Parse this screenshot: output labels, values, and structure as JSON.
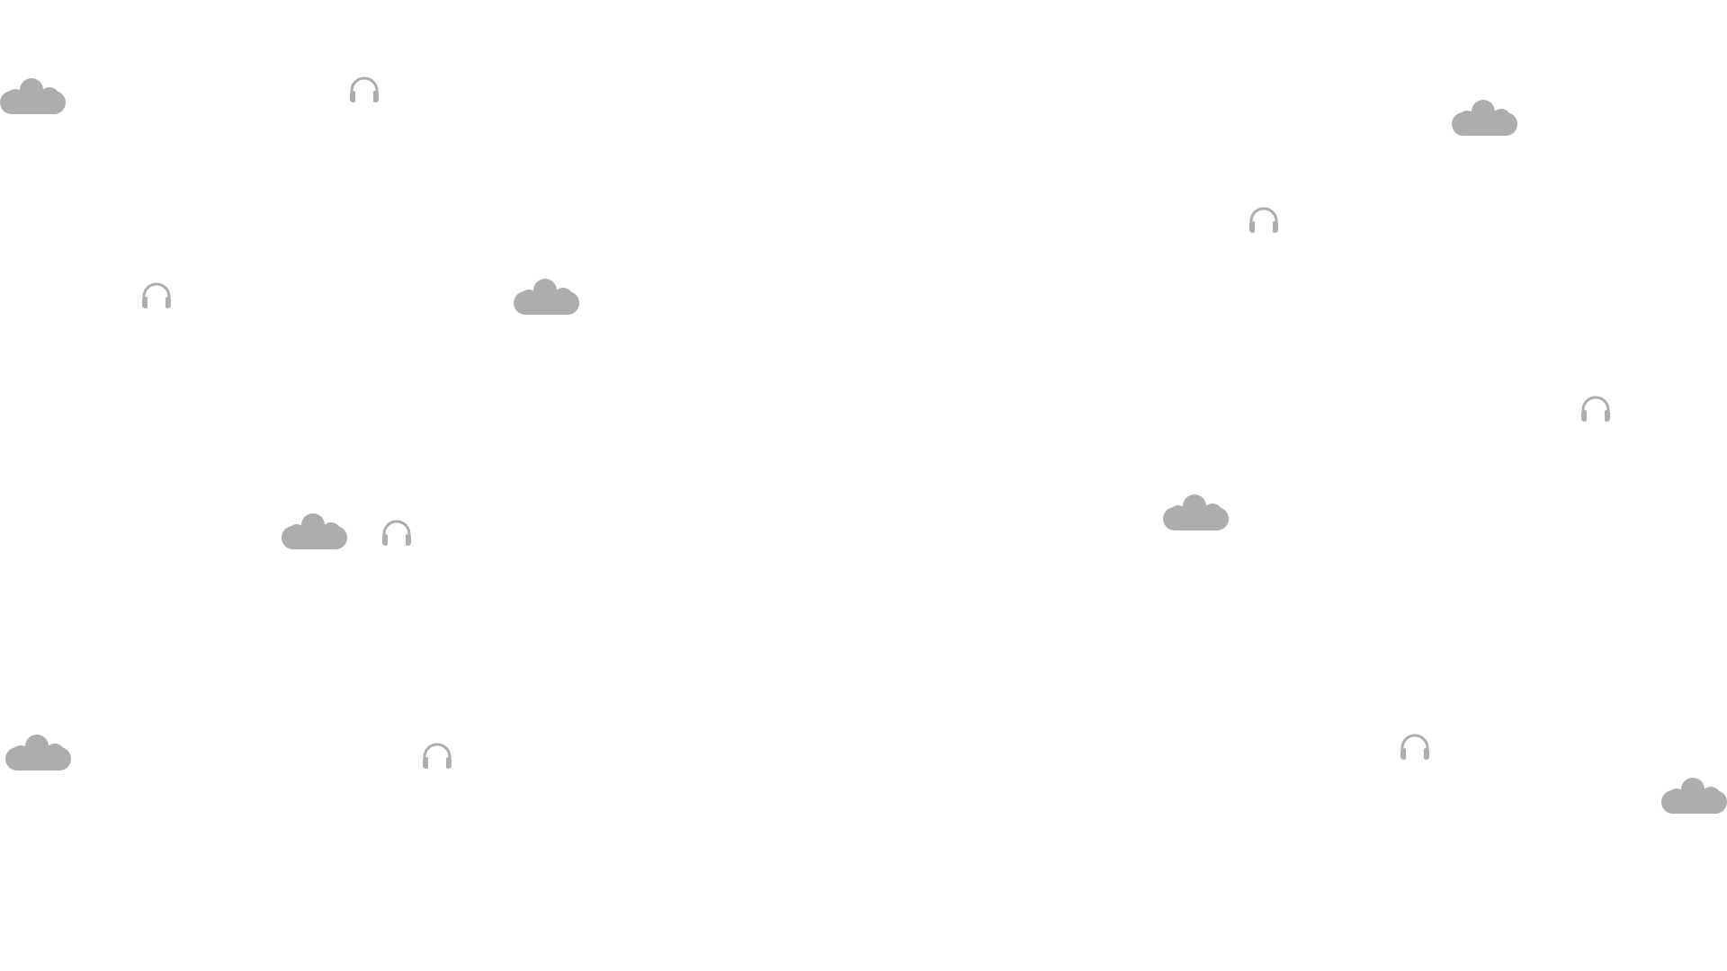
{
  "background": {
    "color": "#ffffff",
    "icon_color": "#adadad",
    "pattern": {
      "clouds": [
        {
          "icon": "cloud-icon"
        },
        {
          "icon": "cloud-icon"
        },
        {
          "icon": "cloud-icon"
        },
        {
          "icon": "cloud-icon"
        },
        {
          "icon": "cloud-icon"
        },
        {
          "icon": "cloud-icon"
        },
        {
          "icon": "cloud-icon"
        }
      ],
      "headphones": [
        {
          "icon": "headphones-icon"
        },
        {
          "icon": "headphones-icon"
        },
        {
          "icon": "headphones-icon"
        },
        {
          "icon": "headphones-icon"
        },
        {
          "icon": "headphones-icon"
        },
        {
          "icon": "headphones-icon"
        },
        {
          "icon": "headphones-icon"
        }
      ]
    }
  }
}
